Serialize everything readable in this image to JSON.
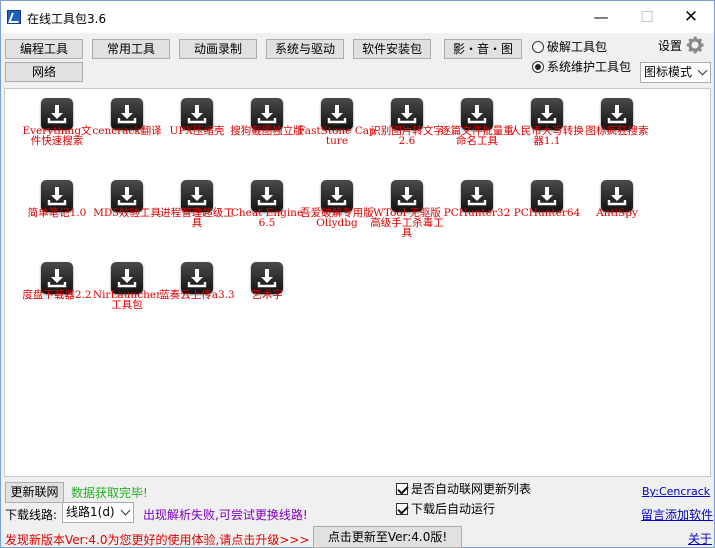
{
  "window": {
    "title": "在线工具包3.6",
    "minimize": "—",
    "maximize": "☐",
    "close": "✕"
  },
  "toolbar": {
    "buttons": [
      "编程工具",
      "常用工具",
      "动画录制",
      "系统与驱动",
      "软件安装包",
      "影・音・图"
    ],
    "network_button": "网络",
    "radio_crack": "破解工具包",
    "radio_maintenance": "系统维护工具包",
    "selected_radio": "系统维护工具包",
    "settings_label": "设置",
    "view_mode": "图标模式"
  },
  "tools": [
    "Everything文件快速搜索",
    "cencrack翻译",
    "UPX压缩壳",
    "搜狗截图独立版",
    "FastStone Capture",
    "识别图片转文字2.6",
    "逐篇文件批量重命名工具",
    "人民币大写转换器1.1",
    "图标疯狂搜索",
    "简单笔记1.0",
    "MD5效验工具",
    "进程管理超级工具",
    "Cheat Engine6.5",
    "吾爱破解专用版Ollydbg",
    "WTool 无驱版高级手工杀毒工具",
    "PCHunter32",
    "PCHunter64",
    "AntiSpy",
    "度盘下载器2.2",
    "NirLauncher工具包",
    "蓝奏云上传a3.3",
    "艺术字"
  ],
  "bottom": {
    "refresh_button": "更新联网",
    "status_text": "数据获取完毕!",
    "auto_update_label": "是否自动联网更新列表",
    "auto_update_checked": true,
    "auto_run_label": "下载后自动运行",
    "auto_run_checked": true,
    "author_link": "By:Cencrack",
    "route_label": "下载线路:",
    "route_value": "线路1(d)",
    "route_hint": "出现解析失败,可尝试更换线路!",
    "feedback_link": "留言添加软件",
    "upgrade_text": "发现新版本Ver:4.0为您更好的使用体验,请点击升级>>>",
    "upgrade_button": "点击更新至Ver:4.0版!",
    "about_link": "关于"
  },
  "colors": {
    "tool_label": "#e00000",
    "status_green": "#22b022",
    "hint_purple": "#8000c0",
    "link_blue": "#0000cc"
  }
}
